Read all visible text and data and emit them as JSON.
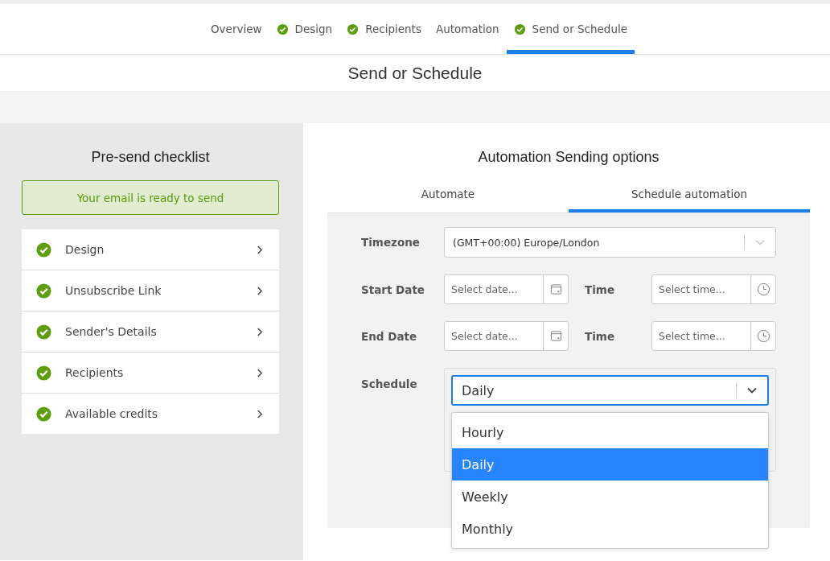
{
  "steps": [
    {
      "label": "Overview",
      "done": false,
      "selected": false
    },
    {
      "label": "Design",
      "done": true,
      "selected": false
    },
    {
      "label": "Recipients",
      "done": true,
      "selected": false
    },
    {
      "label": "Automation",
      "done": false,
      "selected": false
    },
    {
      "label": "Send or Schedule",
      "done": true,
      "selected": true
    }
  ],
  "page_title": "Send or Schedule",
  "checklist": {
    "title": "Pre-send checklist",
    "status": "Your email is ready to send",
    "items": [
      {
        "label": "Design",
        "done": true
      },
      {
        "label": "Unsubscribe Link",
        "done": true
      },
      {
        "label": "Sender's Details",
        "done": true
      },
      {
        "label": "Recipients",
        "done": true
      },
      {
        "label": "Available credits",
        "done": true
      }
    ]
  },
  "options": {
    "title": "Automation Sending options",
    "tabs": [
      {
        "label": "Automate",
        "selected": false
      },
      {
        "label": "Schedule automation",
        "selected": true
      }
    ],
    "timezone": {
      "label": "Timezone",
      "value": "(GMT+00:00) Europe/London"
    },
    "start": {
      "label": "Start Date",
      "date_placeholder": "Select date...",
      "time_label": "Time",
      "time_placeholder": "Select time..."
    },
    "end": {
      "label": "End Date",
      "date_placeholder": "Select date...",
      "time_label": "Time",
      "time_placeholder": "Select time..."
    },
    "schedule": {
      "label": "Schedule",
      "value": "Daily",
      "expanded": true,
      "options": [
        {
          "label": "Hourly",
          "selected": false
        },
        {
          "label": "Daily",
          "selected": true
        },
        {
          "label": "Weekly",
          "selected": false
        },
        {
          "label": "Monthly",
          "selected": false
        }
      ]
    }
  }
}
